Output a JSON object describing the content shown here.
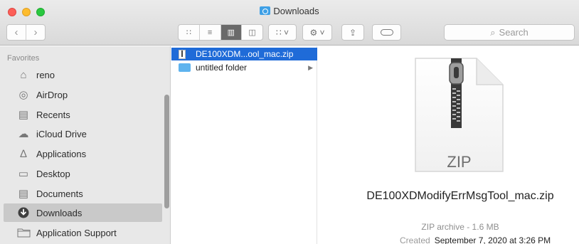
{
  "window": {
    "title": "Downloads"
  },
  "toolbar": {
    "back_label": "‹",
    "forward_label": "›",
    "view_modes": [
      {
        "name": "icon-view",
        "glyph": "∷",
        "active": false
      },
      {
        "name": "list-view",
        "glyph": "≡",
        "active": false
      },
      {
        "name": "column-view",
        "glyph": "▥",
        "active": true
      },
      {
        "name": "gallery-view",
        "glyph": "◫",
        "active": false
      }
    ],
    "arrange_glyph": "∷ ˅",
    "action_glyph": "⚙ ˅",
    "share_glyph": "⇪",
    "search": {
      "placeholder": "Search"
    }
  },
  "sidebar": {
    "heading": "Favorites",
    "items": [
      {
        "label": "reno",
        "icon": "home-icon",
        "glyph": "⌂",
        "selected": false
      },
      {
        "label": "AirDrop",
        "icon": "airdrop-icon",
        "glyph": "◎",
        "selected": false
      },
      {
        "label": "Recents",
        "icon": "recents-icon",
        "glyph": "▤",
        "selected": false
      },
      {
        "label": "iCloud Drive",
        "icon": "cloud-icon",
        "glyph": "☁",
        "selected": false
      },
      {
        "label": "Applications",
        "icon": "applications-icon",
        "glyph": "∆",
        "selected": false
      },
      {
        "label": "Desktop",
        "icon": "desktop-icon",
        "glyph": "▭",
        "selected": false
      },
      {
        "label": "Documents",
        "icon": "documents-icon",
        "glyph": "▤",
        "selected": false
      },
      {
        "label": "Downloads",
        "icon": "downloads-icon",
        "glyph": "⬇",
        "selected": true
      },
      {
        "label": "Application Support",
        "icon": "folder-icon",
        "glyph": "▭",
        "selected": false
      }
    ]
  },
  "column": {
    "items": [
      {
        "label": "DE100XDM...ool_mac.zip",
        "icon": "zip-file-icon",
        "selected": true,
        "has_children": false
      },
      {
        "label": "untitled folder",
        "icon": "folder-icon",
        "selected": false,
        "has_children": true
      }
    ]
  },
  "preview": {
    "icon_label": "ZIP",
    "filename": "DE100XDModifyErrMsgTool_mac.zip",
    "kind_size": "ZIP archive - 1.6 MB",
    "created_label": "Created",
    "created_value": "September 7, 2020 at 3:26 PM"
  },
  "colors": {
    "selection_blue": "#1f6bd8",
    "sidebar_bg": "#e8e8e8",
    "folder_blue": "#5eb3ee"
  }
}
